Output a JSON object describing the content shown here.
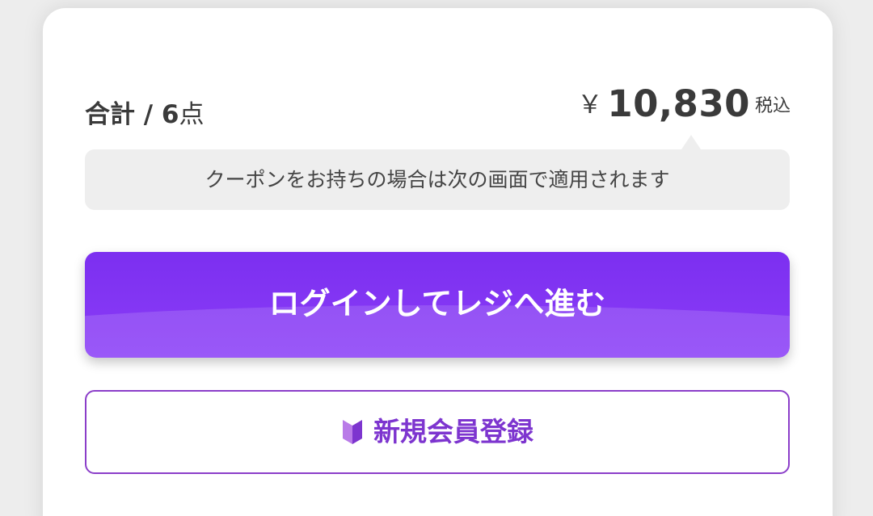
{
  "summary": {
    "label": "合計 / 6",
    "unit": "点",
    "currency": "￥",
    "amount": "10,830",
    "tax": "税込"
  },
  "coupon_note": "クーポンをお持ちの場合は次の画面で適用されます",
  "login_button": {
    "label": "ログインしてレジへ進む"
  },
  "register_button": {
    "label": "新規会員登録",
    "icon": "beginner-mark-icon"
  },
  "colors": {
    "accent": "#8a3df7",
    "register_text": "#7d35cf",
    "register_border": "#8b3ec9"
  }
}
